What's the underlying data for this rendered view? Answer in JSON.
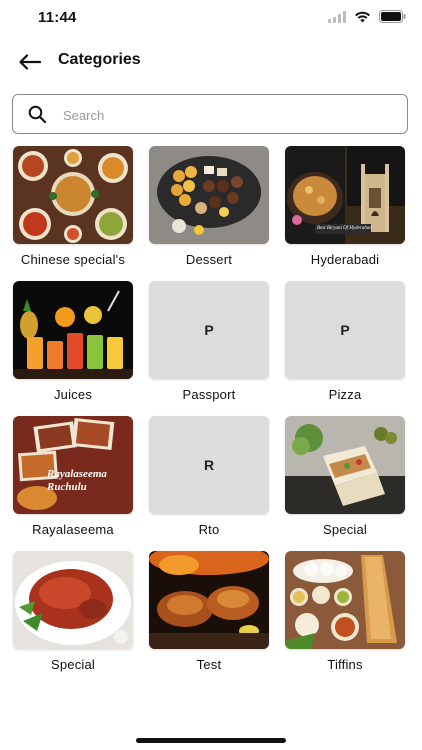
{
  "status": {
    "time": "11:44"
  },
  "header": {
    "title": "Categories"
  },
  "search": {
    "placeholder": "Search"
  },
  "categories": [
    {
      "label": "Chinese special's",
      "type": "image",
      "icon": "chinese-food-image"
    },
    {
      "label": "Dessert",
      "type": "image",
      "icon": "dessert-image"
    },
    {
      "label": "Hyderabadi",
      "type": "image",
      "icon": "hyderabadi-biryani-image",
      "image_caption": "Best Biryani Of Hyderabad"
    },
    {
      "label": "Juices",
      "type": "image",
      "icon": "juices-image"
    },
    {
      "label": "Passport",
      "type": "placeholder",
      "letter": "P"
    },
    {
      "label": "Pizza",
      "type": "placeholder",
      "letter": "P"
    },
    {
      "label": "Rayalaseema",
      "type": "image",
      "icon": "rayalaseema-image",
      "image_caption": "Rayalaseema Ruchulu"
    },
    {
      "label": "Rto",
      "type": "placeholder",
      "letter": "R"
    },
    {
      "label": "Special",
      "type": "image",
      "icon": "wrap-image"
    },
    {
      "label": "Special",
      "type": "image",
      "icon": "tandoori-chicken-image"
    },
    {
      "label": "Test",
      "type": "image",
      "icon": "grilled-chicken-image"
    },
    {
      "label": "Tiffins",
      "type": "image",
      "icon": "tiffins-image"
    }
  ],
  "colors": {
    "placeholder_bg": "#dcdcdc",
    "text": "#111111",
    "search_border": "#8a8a8a"
  }
}
